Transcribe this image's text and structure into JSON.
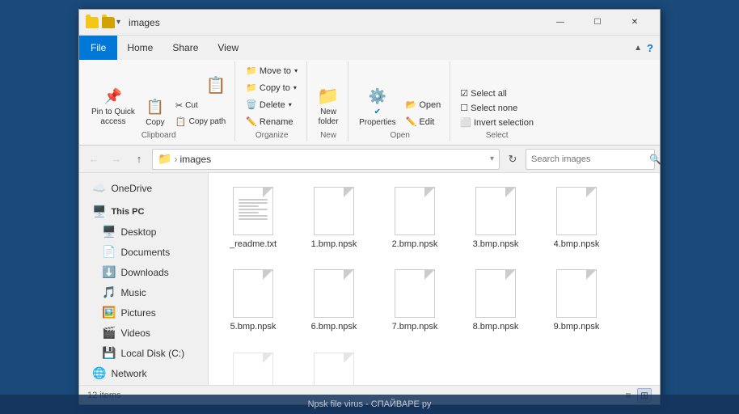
{
  "window": {
    "title": "images",
    "title_icons": [
      "folder-icon1",
      "folder-icon2"
    ],
    "controls": {
      "minimize": "—",
      "maximize": "☐",
      "close": "✕"
    }
  },
  "menu": {
    "file_label": "File",
    "items": [
      "Home",
      "Share",
      "View"
    ]
  },
  "ribbon": {
    "clipboard_group_label": "Clipboard",
    "pin_label": "Pin to Quick\naccess",
    "copy_label": "Copy",
    "paste_label": "Paste",
    "cut_label": "",
    "organize_group_label": "Organize",
    "move_to_label": "Move to",
    "copy_to_label": "Copy to",
    "delete_label": "Delete",
    "rename_label": "Rename",
    "new_group_label": "New",
    "new_folder_label": "New\nfolder",
    "open_group_label": "Open",
    "properties_label": "Properties",
    "select_group_label": "Select",
    "select_all_label": "Select all",
    "select_none_label": "Select none",
    "invert_label": "Invert selection"
  },
  "nav": {
    "back_title": "Back",
    "forward_title": "Forward",
    "up_title": "Up",
    "breadcrumb_folder": "images",
    "search_placeholder": "Search images"
  },
  "sidebar": {
    "onedrive_label": "OneDrive",
    "this_pc_label": "This PC",
    "items": [
      {
        "label": "Desktop",
        "icon": "🖥️"
      },
      {
        "label": "Documents",
        "icon": "📄"
      },
      {
        "label": "Downloads",
        "icon": "⬇️"
      },
      {
        "label": "Music",
        "icon": "🎵"
      },
      {
        "label": "Pictures",
        "icon": "🖼️"
      },
      {
        "label": "Videos",
        "icon": "🎬"
      },
      {
        "label": "Local Disk (C:)",
        "icon": "💾"
      },
      {
        "label": "Network",
        "icon": "🌐"
      }
    ]
  },
  "files": [
    {
      "name": "_readme.txt",
      "type": "text"
    },
    {
      "name": "1.bmp.npsk",
      "type": "doc"
    },
    {
      "name": "2.bmp.npsk",
      "type": "doc"
    },
    {
      "name": "3.bmp.npsk",
      "type": "doc"
    },
    {
      "name": "4.bmp.npsk",
      "type": "doc"
    },
    {
      "name": "5.bmp.npsk",
      "type": "doc"
    },
    {
      "name": "6.bmp.npsk",
      "type": "doc"
    },
    {
      "name": "7.bmp.npsk",
      "type": "doc"
    },
    {
      "name": "8.bmp.npsk",
      "type": "doc"
    },
    {
      "name": "9.bmp.npsk",
      "type": "doc"
    }
  ],
  "status": {
    "item_count": "12 items"
  },
  "taskbar": {
    "label": "Npsk file virus - СПАЙВАРЕ ру"
  }
}
